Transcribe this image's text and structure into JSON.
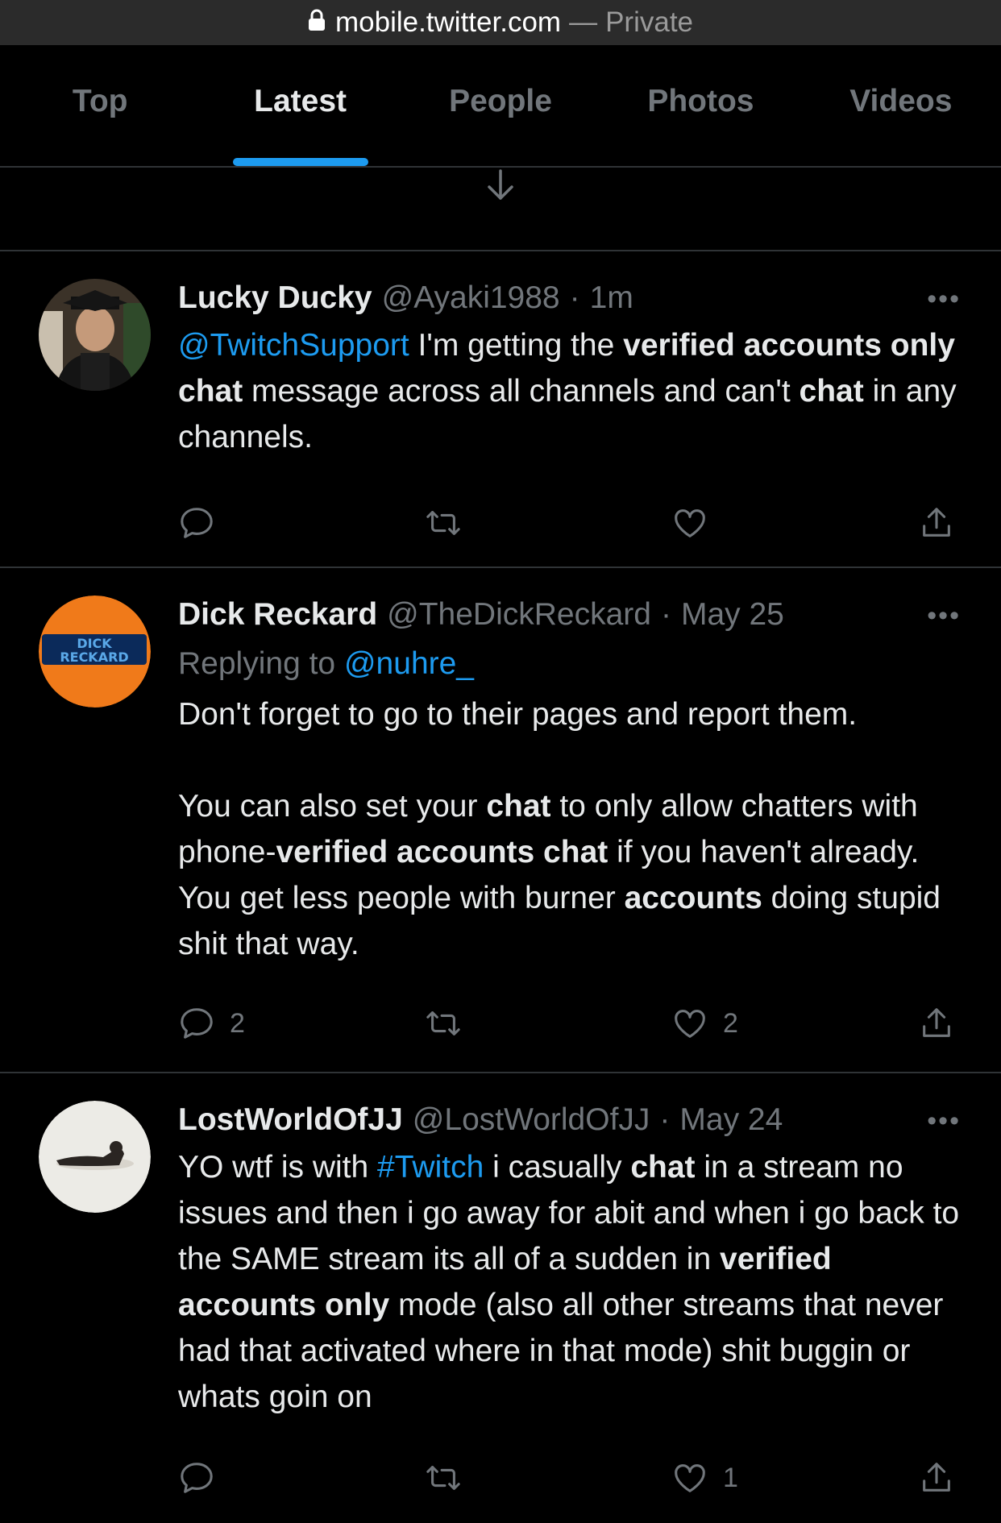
{
  "browser": {
    "url": "mobile.twitter.com",
    "separator": "—",
    "mode": "Private"
  },
  "tabs": [
    {
      "label": "Top",
      "active": false
    },
    {
      "label": "Latest",
      "active": true
    },
    {
      "label": "People",
      "active": false
    },
    {
      "label": "Photos",
      "active": false
    },
    {
      "label": "Videos",
      "active": false
    }
  ],
  "tweets": [
    {
      "name": "Lucky Ducky",
      "handle": "@Ayaki1988",
      "dot": "·",
      "time": "1m",
      "mention": "@TwitchSupport",
      "t1": " I'm getting the ",
      "b1": "verified accounts only chat",
      "t2": " message across all channels and can't ",
      "b2": "chat",
      "t3": " in any channels.",
      "replies": "",
      "likes": ""
    },
    {
      "name": "Dick Reckard",
      "handle": "@TheDickReckard",
      "dot": "·",
      "time": "May 25",
      "replying_label": "Replying to",
      "replying_to": "@nuhre_",
      "p1": "Don't forget to go to their pages and report them.",
      "t1": "You can also set your ",
      "b1": "chat",
      "t2": " to only allow chatters with phone-",
      "b2": "verified accounts chat",
      "t3": " if you haven't already. You get less people with burner ",
      "b3": "accounts",
      "t4": " doing stupid shit that way.",
      "replies": "2",
      "likes": "2"
    },
    {
      "name": "LostWorldOfJJ",
      "handle": "@LostWorldOfJJ",
      "dot": "·",
      "time": "May 24",
      "t1": "YO wtf is with ",
      "hashtag": "#Twitch",
      "t2": " i casually ",
      "b1": "chat",
      "t3": " in a stream no issues and then i go away for abit and when i go back to the SAME stream its all of a sudden in ",
      "b2": "verified accounts only",
      "t4": " mode (also all other streams that never had that activated where in that mode) shit buggin or whats goin on",
      "replies": "",
      "likes": "1"
    }
  ],
  "avatar_logo_text": "DICK RECKARD",
  "colors": {
    "accent": "#1d9bf0",
    "muted": "#71767b",
    "divider": "#2f3336",
    "background": "#000000"
  }
}
